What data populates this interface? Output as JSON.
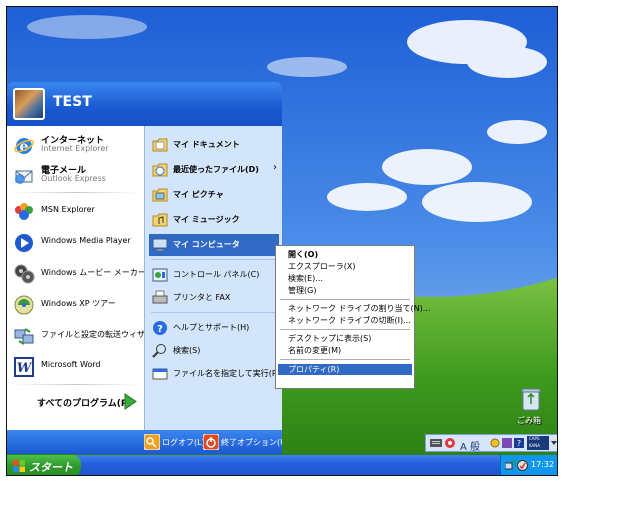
{
  "user": {
    "name": "TEST"
  },
  "pinned": [
    {
      "title": "インターネット",
      "subtitle": "Internet Explorer",
      "icon": "internet-explorer-icon"
    },
    {
      "title": "電子メール",
      "subtitle": "Outlook Express",
      "icon": "outlook-express-icon"
    }
  ],
  "recent": [
    {
      "label": "MSN Explorer",
      "icon": "msn-explorer-icon"
    },
    {
      "label": "Windows Media Player",
      "icon": "windows-media-player-icon"
    },
    {
      "label": "Windows ムービー メーカー",
      "icon": "movie-maker-icon"
    },
    {
      "label": "Windows XP ツアー",
      "icon": "xp-tour-icon"
    },
    {
      "label": "ファイルと設定の転送ウィザード",
      "icon": "transfer-wizard-icon"
    },
    {
      "label": "Microsoft Word",
      "icon": "word-icon"
    }
  ],
  "all_programs": {
    "label": "すべてのプログラム(P)"
  },
  "places": [
    {
      "label": "マイ ドキュメント",
      "icon": "my-documents-icon"
    },
    {
      "label": "最近使ったファイル(D)",
      "icon": "recent-files-icon",
      "arrow": "›"
    },
    {
      "label": "マイ ピクチャ",
      "icon": "my-pictures-icon"
    },
    {
      "label": "マイ ミュージック",
      "icon": "my-music-icon"
    },
    {
      "label": "マイ コンピュータ",
      "icon": "my-computer-icon"
    },
    {
      "label": "コントロール パネル(C)",
      "icon": "control-panel-icon"
    },
    {
      "label": "プリンタと FAX",
      "icon": "printers-icon"
    },
    {
      "label": "ヘルプとサポート(H)",
      "icon": "help-icon"
    },
    {
      "label": "検索(S)",
      "icon": "search-icon"
    },
    {
      "label": "ファイル名を指定して実行(R)...",
      "icon": "run-icon"
    }
  ],
  "footer": {
    "logoff": "ログオフ(L)",
    "shutdown": "終了オプション(U)"
  },
  "context_menu": [
    {
      "label": "開く(O)"
    },
    {
      "label": "エクスプローラ(X)"
    },
    {
      "label": "検索(E)..."
    },
    {
      "label": "管理(G)"
    },
    {
      "label": "ネットワーク ドライブの割り当て(N)..."
    },
    {
      "label": "ネットワーク ドライブの切断(I)..."
    },
    {
      "label": "デスクトップに表示(S)"
    },
    {
      "label": "名前の変更(M)"
    },
    {
      "label": "プロパティ(R)"
    }
  ],
  "desktop": {
    "recycle_bin": "ごみ箱"
  },
  "taskbar": {
    "start": "スタート",
    "clock": "17:32"
  },
  "language_bar": {
    "mode": "A 般",
    "caps": "CAPS",
    "kana": "KANA"
  },
  "colors": {
    "taskbar": "#245edb",
    "start_button": "#2f9a2c",
    "selection": "#316ac5",
    "menu_header": "#1a58d0"
  }
}
